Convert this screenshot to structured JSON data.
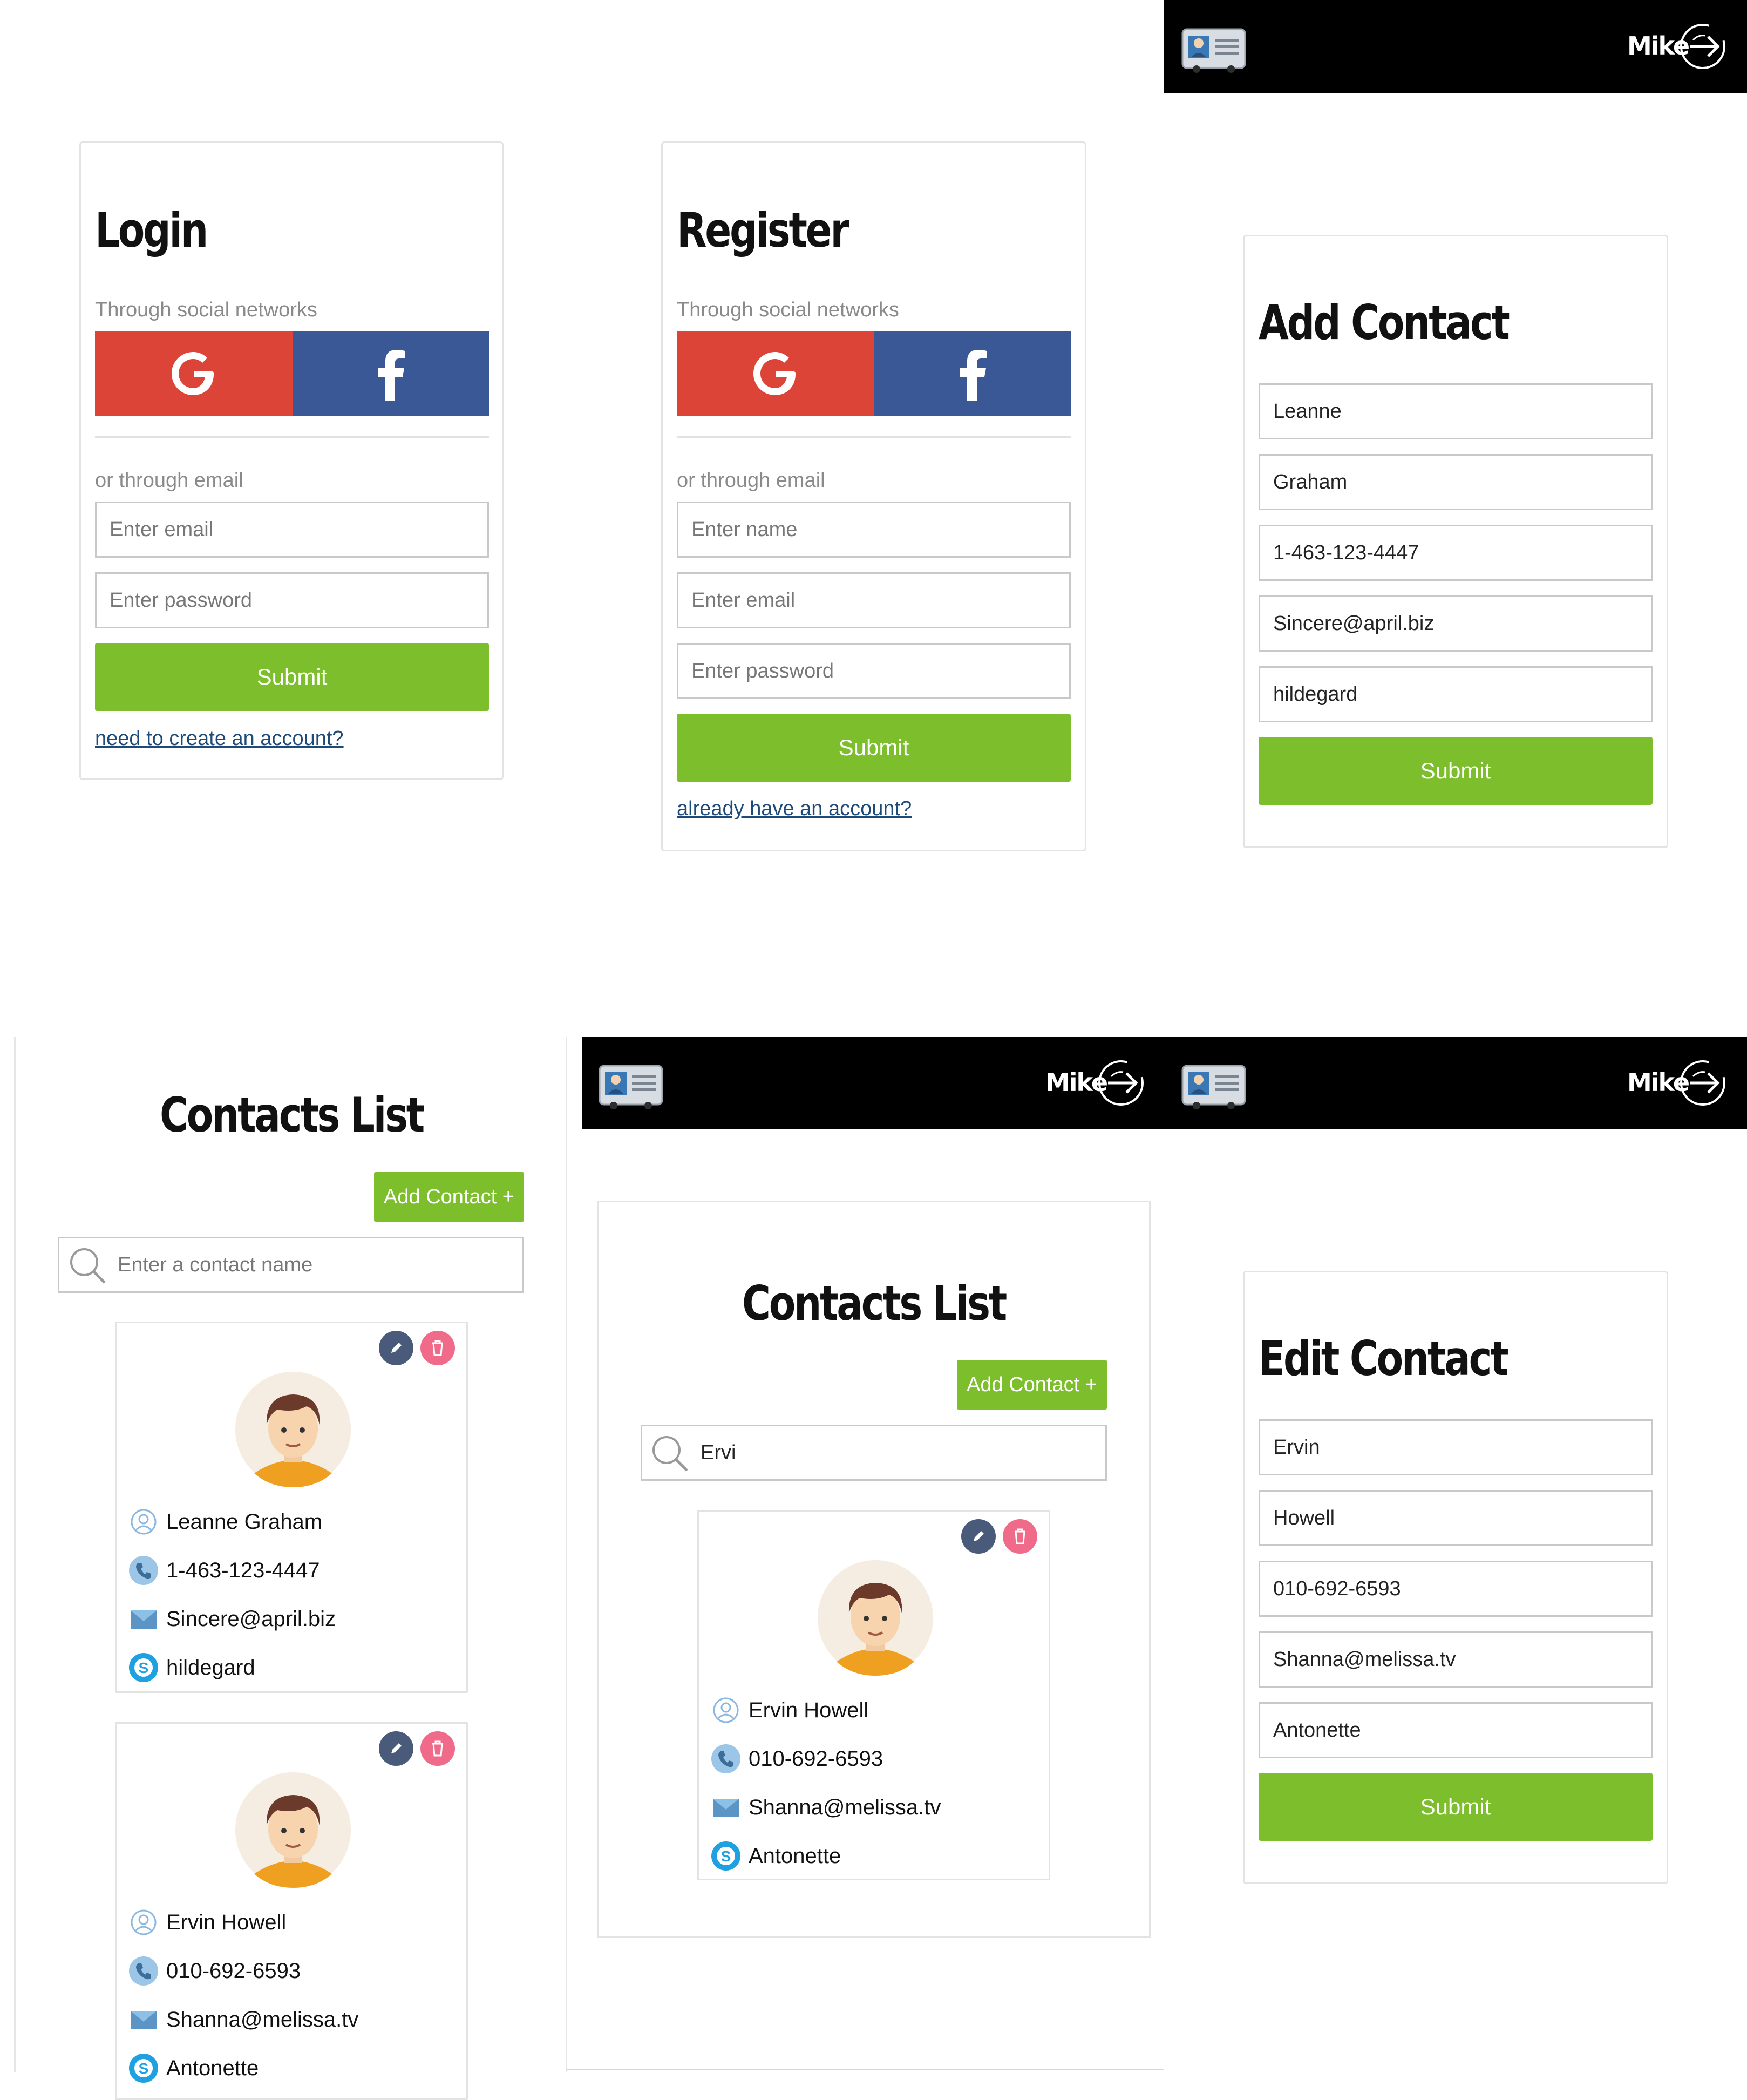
{
  "header": {
    "user_name": "Mike"
  },
  "login": {
    "title": "Login",
    "social_label": "Through social networks",
    "email_label": "or through email",
    "email_placeholder": "Enter email",
    "password_placeholder": "Enter password",
    "submit": "Submit",
    "link": "need to create an account?"
  },
  "register": {
    "title": "Register",
    "social_label": "Through social networks",
    "email_label": "or through email",
    "name_placeholder": "Enter name",
    "email_placeholder": "Enter email",
    "password_placeholder": "Enter password",
    "submit": "Submit",
    "link": "already have an account?"
  },
  "add_contact": {
    "title": "Add Contact",
    "fields": [
      "Leanne",
      "Graham",
      "1-463-123-4447",
      "Sincere@april.biz",
      "hildegard"
    ],
    "submit": "Submit"
  },
  "contacts_list_1": {
    "title": "Contacts List",
    "add_button": "Add Contact +",
    "search_placeholder": "Enter a contact name",
    "contacts": [
      {
        "name": "Leanne Graham",
        "phone": "1-463-123-4447",
        "email": "Sincere@april.biz",
        "skype": "hildegard"
      },
      {
        "name": "Ervin Howell",
        "phone": "010-692-6593",
        "email": "Shanna@melissa.tv",
        "skype": "Antonette"
      }
    ]
  },
  "contacts_list_2": {
    "title": "Contacts List",
    "add_button": "Add Contact +",
    "search_value": "Ervi",
    "contacts": [
      {
        "name": "Ervin Howell",
        "phone": "010-692-6593",
        "email": "Shanna@melissa.tv",
        "skype": "Antonette"
      }
    ]
  },
  "edit_contact": {
    "title": "Edit Contact",
    "fields": [
      "Ervin",
      "Howell",
      "010-692-6593",
      "Shanna@melissa.tv",
      "Antonette"
    ],
    "submit": "Submit"
  },
  "colors": {
    "google": "#dd4438",
    "facebook": "#3a5895",
    "green": "#7dbe2d",
    "edit_btn": "#4a5a7a",
    "delete_btn": "#f06a8a",
    "topbar": "#000000"
  },
  "icons": [
    "contact-card-icon",
    "logout-icon",
    "google-icon",
    "facebook-icon",
    "search-icon",
    "edit-icon",
    "trash-icon",
    "user-icon",
    "phone-icon",
    "mail-icon",
    "skype-icon",
    "avatar"
  ]
}
